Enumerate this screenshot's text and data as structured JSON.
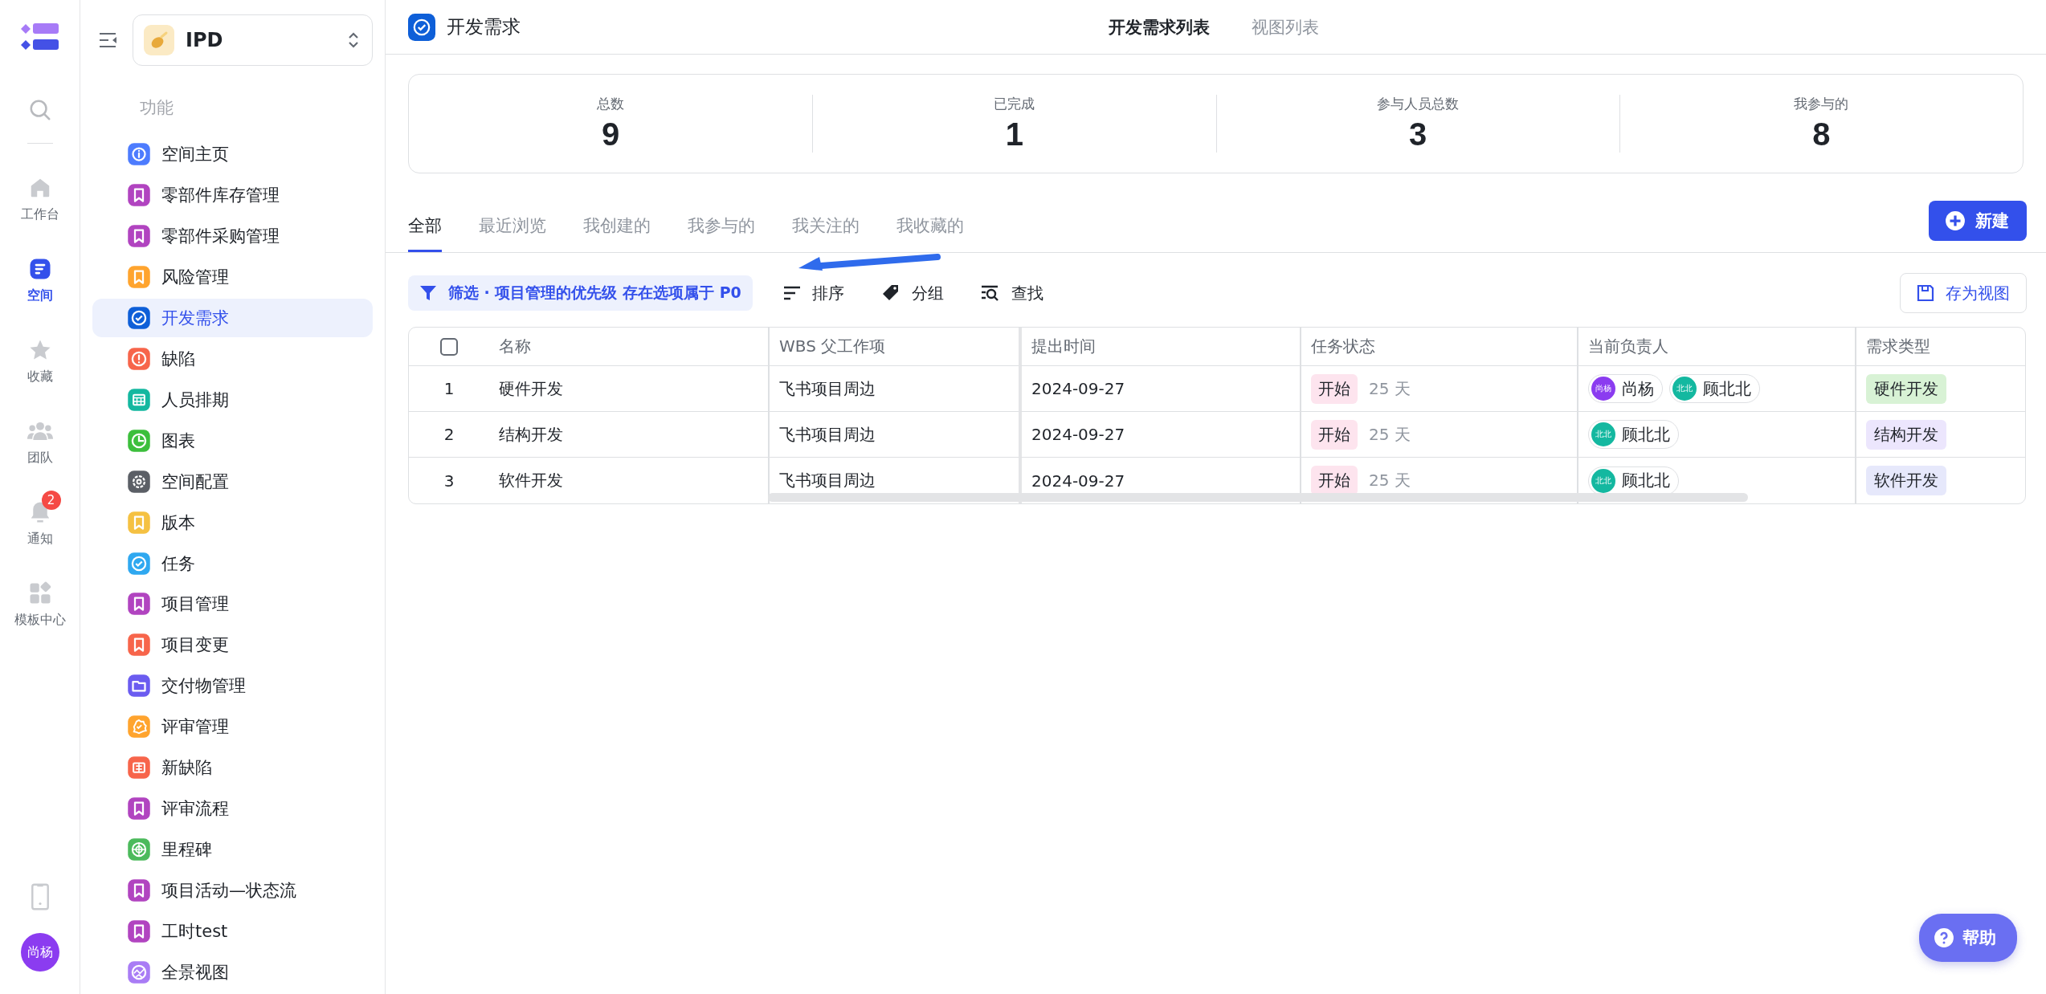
{
  "rail": {
    "items": [
      {
        "label": "工作台",
        "kind": "home",
        "selected": false
      },
      {
        "label": "空间",
        "kind": "space",
        "selected": true
      },
      {
        "label": "收藏",
        "kind": "star",
        "selected": false
      },
      {
        "label": "团队",
        "kind": "team",
        "selected": false
      },
      {
        "label": "通知",
        "kind": "bell",
        "selected": false,
        "badge": "2"
      },
      {
        "label": "模板中心",
        "kind": "apps",
        "selected": false
      }
    ],
    "avatar": "尚杨"
  },
  "sidebar": {
    "space": "IPD",
    "section": "功能",
    "items": [
      {
        "label": "空间主页",
        "kind": "info",
        "color": "#4d7cfe",
        "selected": false
      },
      {
        "label": "零部件库存管理",
        "kind": "bookmark",
        "color": "#b144c0",
        "selected": false
      },
      {
        "label": "零部件采购管理",
        "kind": "bookmark",
        "color": "#b144c0",
        "selected": false
      },
      {
        "label": "风险管理",
        "kind": "bookmark",
        "color": "#ffa42e",
        "selected": false
      },
      {
        "label": "开发需求",
        "kind": "check",
        "color": "#0e5fd8",
        "selected": true
      },
      {
        "label": "缺陷",
        "kind": "alert",
        "color": "#f7654b",
        "selected": false
      },
      {
        "label": "人员排期",
        "kind": "calendar",
        "color": "#14b8a0",
        "selected": false
      },
      {
        "label": "图表",
        "kind": "chart",
        "color": "#3cbf3c",
        "selected": false
      },
      {
        "label": "空间配置",
        "kind": "gear",
        "color": "#5b5f66",
        "selected": false
      },
      {
        "label": "版本",
        "kind": "bookmark",
        "color": "#f5c142",
        "selected": false
      },
      {
        "label": "任务",
        "kind": "check",
        "color": "#2fa8f0",
        "selected": false
      },
      {
        "label": "项目管理",
        "kind": "bookmark",
        "color": "#b144c0",
        "selected": false
      },
      {
        "label": "项目变更",
        "kind": "bookmark",
        "color": "#f7654b",
        "selected": false
      },
      {
        "label": "交付物管理",
        "kind": "folder",
        "color": "#6b5cf0",
        "selected": false
      },
      {
        "label": "评审管理",
        "kind": "badge",
        "color": "#ffa42e",
        "selected": false
      },
      {
        "label": "新缺陷",
        "kind": "book",
        "color": "#f7654b",
        "selected": false
      },
      {
        "label": "评审流程",
        "kind": "bookmark",
        "color": "#b144c0",
        "selected": false
      },
      {
        "label": "里程碑",
        "kind": "target",
        "color": "#4cba5c",
        "selected": false
      },
      {
        "label": "项目活动—状态流",
        "kind": "bookmark",
        "color": "#b144c0",
        "selected": false
      },
      {
        "label": "工时test",
        "kind": "bookmark",
        "color": "#b144c0",
        "selected": false
      },
      {
        "label": "全景视图",
        "kind": "globe",
        "color": "#a97cf5",
        "selected": false
      }
    ]
  },
  "header": {
    "title": "开发需求",
    "tabs": [
      {
        "label": "开发需求列表",
        "selected": true
      },
      {
        "label": "视图列表",
        "selected": false
      }
    ]
  },
  "stats": [
    {
      "label": "总数",
      "value": "9"
    },
    {
      "label": "已完成",
      "value": "1"
    },
    {
      "label": "参与人员总数",
      "value": "3"
    },
    {
      "label": "我参与的",
      "value": "8"
    }
  ],
  "view_tabs": [
    {
      "label": "全部",
      "selected": true
    },
    {
      "label": "最近浏览",
      "selected": false
    },
    {
      "label": "我创建的",
      "selected": false
    },
    {
      "label": "我参与的",
      "selected": false
    },
    {
      "label": "我关注的",
      "selected": false
    },
    {
      "label": "我收藏的",
      "selected": false
    }
  ],
  "new_button": "新建",
  "toolbar": {
    "filter": "筛选 · 项目管理的优先级 存在选项属于 P0",
    "actions": [
      {
        "label": "排序",
        "kind": "sort"
      },
      {
        "label": "分组",
        "kind": "tag"
      },
      {
        "label": "查找",
        "kind": "find"
      }
    ],
    "save_view": "存为视图"
  },
  "table": {
    "select_all": {
      "checked": false
    },
    "columns": [
      "名称",
      "WBS 父工作项",
      "提出时间",
      "任务状态",
      "当前负责人",
      "需求类型"
    ],
    "rows": [
      {
        "index": "1",
        "name": "硬件开发",
        "wbs": "飞书项目周边",
        "date": "2024-09-27",
        "status": "开始",
        "duration": "25 天",
        "owners": [
          {
            "avatar": "尚杨",
            "name": "尚杨",
            "color": "#8b3cf0"
          },
          {
            "avatar": "北北",
            "name": "顾北北",
            "color": "#14b8a0"
          }
        ],
        "type": {
          "label": "硬件开发",
          "color": "#d8f2d5"
        }
      },
      {
        "index": "2",
        "name": "结构开发",
        "wbs": "飞书项目周边",
        "date": "2024-09-27",
        "status": "开始",
        "duration": "25 天",
        "owners": [
          {
            "avatar": "北北",
            "name": "顾北北",
            "color": "#14b8a0"
          }
        ],
        "type": {
          "label": "结构开发",
          "color": "#ece6fd"
        }
      },
      {
        "index": "3",
        "name": "软件开发",
        "wbs": "飞书项目周边",
        "date": "2024-09-27",
        "status": "开始",
        "duration": "25 天",
        "owners": [
          {
            "avatar": "北北",
            "name": "顾北北",
            "color": "#14b8a0"
          }
        ],
        "type": {
          "label": "软件开发",
          "color": "#e6e8fb"
        }
      }
    ]
  },
  "help": "帮助"
}
